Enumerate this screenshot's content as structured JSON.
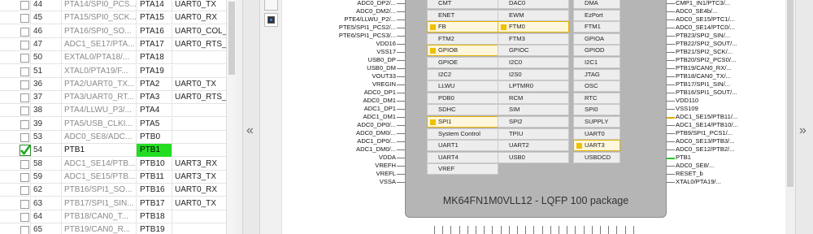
{
  "pin_table": {
    "rows": [
      {
        "num": "44",
        "name": "PTA14/SPI0_PCS...",
        "port": "PTA14",
        "func": "UART0_TX",
        "selected": false
      },
      {
        "num": "45",
        "name": "PTA15/SPI0_SCK...",
        "port": "PTA15",
        "func": "UART0_RX",
        "selected": false
      },
      {
        "num": "46",
        "name": "PTA16/SPI0_SO...",
        "port": "PTA16",
        "func": "UART0_COL_",
        "selected": false
      },
      {
        "num": "47",
        "name": "ADC1_SE17/PTA...",
        "port": "PTA17",
        "func": "UART0_RTS_b",
        "selected": false
      },
      {
        "num": "50",
        "name": "EXTAL0/PTA18/...",
        "port": "PTA18",
        "func": "",
        "selected": false
      },
      {
        "num": "51",
        "name": "XTAL0/PTA19/F...",
        "port": "PTA19",
        "func": "",
        "selected": false
      },
      {
        "num": "36",
        "name": "PTA2/UART0_TX...",
        "port": "PTA2",
        "func": "UART0_TX",
        "selected": false
      },
      {
        "num": "37",
        "name": "PTA3/UART0_RT...",
        "port": "PTA3",
        "func": "UART0_RTS_b",
        "selected": false
      },
      {
        "num": "38",
        "name": "PTA4/LLWU_P3/...",
        "port": "PTA4",
        "func": "",
        "selected": false
      },
      {
        "num": "39",
        "name": "PTA5/USB_CLKI...",
        "port": "PTA5",
        "func": "",
        "selected": false
      },
      {
        "num": "53",
        "name": "ADC0_SE8/ADC...",
        "port": "PTB0",
        "func": "",
        "selected": false
      },
      {
        "num": "54",
        "name": "PTB1",
        "port": "PTB1",
        "func": "",
        "selected": true
      },
      {
        "num": "58",
        "name": "ADC1_SE14/PTB...",
        "port": "PTB10",
        "func": "UART3_RX",
        "selected": false
      },
      {
        "num": "59",
        "name": "ADC1_SE15/PTB...",
        "port": "PTB11",
        "func": "UART3_TX",
        "selected": false
      },
      {
        "num": "62",
        "name": "PTB16/SPI1_SO...",
        "port": "PTB16",
        "func": "UART0_RX",
        "selected": false
      },
      {
        "num": "63",
        "name": "PTB17/SPI1_SIN...",
        "port": "PTB17",
        "func": "UART0_TX",
        "selected": false
      },
      {
        "num": "64",
        "name": "PTB18/CAN0_T...",
        "port": "PTB18",
        "func": "",
        "selected": false
      },
      {
        "num": "65",
        "name": "PTB19/CAN0_R...",
        "port": "PTB19",
        "func": "",
        "selected": false
      }
    ]
  },
  "collapse": {
    "left_label": "«",
    "right_label": "»"
  },
  "chip": {
    "title": "MK64FN1M0VLL12 - LQFP 100 package",
    "peripherals": [
      {
        "label": "CMT",
        "used": false
      },
      {
        "label": "DAC0",
        "used": false
      },
      {
        "label": "DMA",
        "used": false
      },
      {
        "label": "ENET",
        "used": false
      },
      {
        "label": "EWM",
        "used": false
      },
      {
        "label": "EzPort",
        "used": false
      },
      {
        "label": "FB",
        "used": true
      },
      {
        "label": "FTM0",
        "used": true
      },
      {
        "label": "FTM1",
        "used": false
      },
      {
        "label": "FTM2",
        "used": false
      },
      {
        "label": "FTM3",
        "used": false
      },
      {
        "label": "GPIOA",
        "used": false
      },
      {
        "label": "GPIOB",
        "used": true
      },
      {
        "label": "GPIOC",
        "used": false
      },
      {
        "label": "GPIOD",
        "used": false
      },
      {
        "label": "GPIOE",
        "used": false
      },
      {
        "label": "I2C0",
        "used": false
      },
      {
        "label": "I2C1",
        "used": false
      },
      {
        "label": "I2C2",
        "used": false
      },
      {
        "label": "I2S0",
        "used": false
      },
      {
        "label": "JTAG",
        "used": false
      },
      {
        "label": "LLWU",
        "used": false
      },
      {
        "label": "LPTMR0",
        "used": false
      },
      {
        "label": "OSC",
        "used": false
      },
      {
        "label": "PDB0",
        "used": false
      },
      {
        "label": "RCM",
        "used": false
      },
      {
        "label": "RTC",
        "used": false
      },
      {
        "label": "SDHC",
        "used": false
      },
      {
        "label": "SIM",
        "used": false
      },
      {
        "label": "SPI0",
        "used": false
      },
      {
        "label": "SPI1",
        "used": true
      },
      {
        "label": "SPI2",
        "used": false
      },
      {
        "label": "SUPPLY",
        "used": false
      },
      {
        "label": "System Control",
        "used": false
      },
      {
        "label": "TPIU",
        "used": false
      },
      {
        "label": "UART0",
        "used": false
      },
      {
        "label": "UART1",
        "used": false
      },
      {
        "label": "UART2",
        "used": false
      },
      {
        "label": "UART3",
        "used": true
      },
      {
        "label": "UART4",
        "used": false
      },
      {
        "label": "USB0",
        "used": false
      },
      {
        "label": "USBDCD",
        "used": false
      },
      {
        "label": "VREF",
        "used": false
      }
    ],
    "left_pins": [
      {
        "label": "ADC0_DP2/...",
        "state": "normal"
      },
      {
        "label": "ADC0_DM2/...",
        "state": "normal"
      },
      {
        "label": "PTE4/LLWU_P2/...",
        "state": "normal"
      },
      {
        "label": "PTE5/SPI1_PCS2/...",
        "state": "normal"
      },
      {
        "label": "PTE6/SPI1_PCS3/...",
        "state": "normal"
      },
      {
        "label": "VDD16",
        "state": "normal"
      },
      {
        "label": "VSS17",
        "state": "normal"
      },
      {
        "label": "USB0_DP",
        "state": "normal"
      },
      {
        "label": "USB0_DM",
        "state": "normal"
      },
      {
        "label": "VOUT33",
        "state": "normal"
      },
      {
        "label": "VREGIN",
        "state": "normal"
      },
      {
        "label": "ADC0_DP1",
        "state": "normal"
      },
      {
        "label": "ADC0_DM1",
        "state": "normal"
      },
      {
        "label": "ADC1_DP1",
        "state": "normal"
      },
      {
        "label": "ADC1_DM1",
        "state": "normal"
      },
      {
        "label": "ADC0_DP0/...",
        "state": "normal"
      },
      {
        "label": "ADC0_DM0/...",
        "state": "normal"
      },
      {
        "label": "ADC1_DP0/...",
        "state": "normal"
      },
      {
        "label": "ADC1_DM0/...",
        "state": "normal"
      },
      {
        "label": "VDDA",
        "state": "normal"
      },
      {
        "label": "VREFH",
        "state": "normal"
      },
      {
        "label": "VREFL",
        "state": "normal"
      },
      {
        "label": "VSSA",
        "state": "normal"
      }
    ],
    "right_pins": [
      {
        "label": "CMP1_IN1/PTC3/...",
        "state": "normal"
      },
      {
        "label": "ADC0_SE4b/...",
        "state": "normal"
      },
      {
        "label": "ADC0_SE15/PTC1/...",
        "state": "normal"
      },
      {
        "label": "ADC0_SE14/PTC0/...",
        "state": "normal"
      },
      {
        "label": "PTB23/SPI2_SIN/...",
        "state": "normal"
      },
      {
        "label": "PTB22/SPI2_SOUT/...",
        "state": "normal"
      },
      {
        "label": "PTB21/SPI2_SCK/...",
        "state": "normal"
      },
      {
        "label": "PTB20/SPI2_PCS0/...",
        "state": "normal"
      },
      {
        "label": "PTB19/CAN0_RX/...",
        "state": "normal"
      },
      {
        "label": "PTB18/CAN0_TX/...",
        "state": "normal"
      },
      {
        "label": "PTB17/SPI1_SIN/...",
        "state": "normal"
      },
      {
        "label": "PTB16/SPI1_SOUT/...",
        "state": "normal"
      },
      {
        "label": "VDD110",
        "state": "normal"
      },
      {
        "label": "VSS109",
        "state": "normal"
      },
      {
        "label": "ADC1_SE15/PTB11/...",
        "state": "active"
      },
      {
        "label": "ADC1_SE14/PTB10/...",
        "state": "normal"
      },
      {
        "label": "PTB9/SPI1_PCS1/...",
        "state": "normal"
      },
      {
        "label": "ADC0_SE13/PTB3/...",
        "state": "normal"
      },
      {
        "label": "ADC0_SE12/PTB2/...",
        "state": "normal"
      },
      {
        "label": "PTB1",
        "state": "green"
      },
      {
        "label": "ADC0_SE8/...",
        "state": "normal"
      },
      {
        "label": "RESET_b",
        "state": "normal"
      },
      {
        "label": "XTAL0/PTA19/...",
        "state": "normal"
      }
    ]
  },
  "colors": {
    "selected_port": "#22dd22",
    "used_peripheral": "#f0c000",
    "active_pin": "#e0a800"
  }
}
